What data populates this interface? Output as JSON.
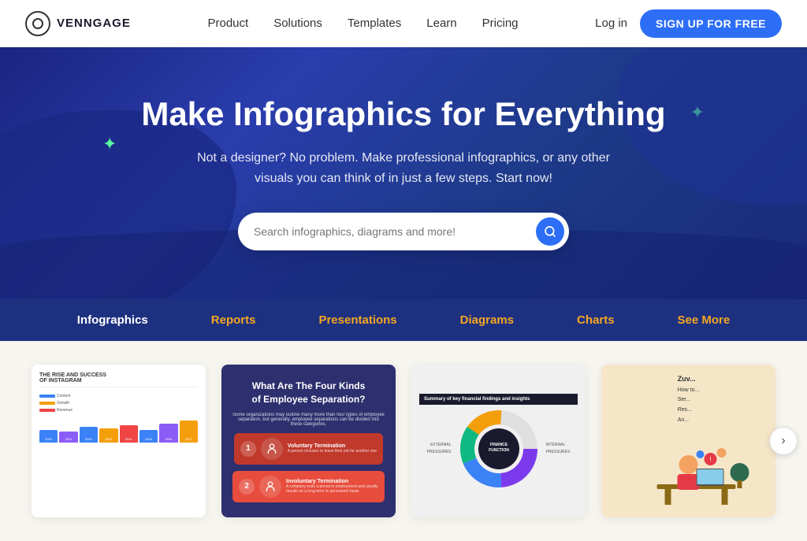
{
  "brand": {
    "name": "VENNGAGE"
  },
  "navbar": {
    "links": [
      {
        "label": "Product",
        "id": "product"
      },
      {
        "label": "Solutions",
        "id": "solutions"
      },
      {
        "label": "Templates",
        "id": "templates"
      },
      {
        "label": "Learn",
        "id": "learn"
      },
      {
        "label": "Pricing",
        "id": "pricing"
      }
    ],
    "login_label": "Log in",
    "signup_label": "SIGN UP FOR FREE"
  },
  "hero": {
    "title": "Make Infographics for Everything",
    "subtitle": "Not a designer? No problem. Make professional infographics, or any other visuals you can think of in just a few steps. Start now!",
    "search_placeholder": "Search infographics, diagrams and more!"
  },
  "categories": [
    {
      "label": "Infographics",
      "active": true
    },
    {
      "label": "Reports",
      "active": false
    },
    {
      "label": "Presentations",
      "active": false
    },
    {
      "label": "Diagrams",
      "active": false
    },
    {
      "label": "Charts",
      "active": false
    },
    {
      "label": "See More",
      "active": false
    }
  ],
  "gallery": {
    "cards": [
      {
        "id": "instagram",
        "title": "THE RISE AND SUCCESS OF INSTAGRAM"
      },
      {
        "id": "employee",
        "title": "What Are The Four Kinds of Employee Separation?",
        "subtitle": "Some organizations may outline many more than four types of employee separation, but generally, employee separations can be divided into these categories.",
        "item1": "Voluntary Termination",
        "item2": "Involuntary Termination"
      },
      {
        "id": "finance",
        "title": "Summary of key financial findings and insights"
      },
      {
        "id": "illustration",
        "title": "How to..."
      }
    ],
    "next_arrow": "›"
  },
  "timeline_bars": [
    {
      "color": "#3b82f6",
      "year": "2010"
    },
    {
      "color": "#8b5cf6",
      "year": "2011"
    },
    {
      "color": "#3b82f6",
      "year": "2012"
    },
    {
      "color": "#f59e0b",
      "year": "2013"
    },
    {
      "color": "#ef4444",
      "year": "2014"
    },
    {
      "color": "#3b82f6",
      "year": "2015"
    },
    {
      "color": "#8b5cf6",
      "year": "2016"
    },
    {
      "color": "#f59e0b",
      "year": "2017"
    }
  ]
}
